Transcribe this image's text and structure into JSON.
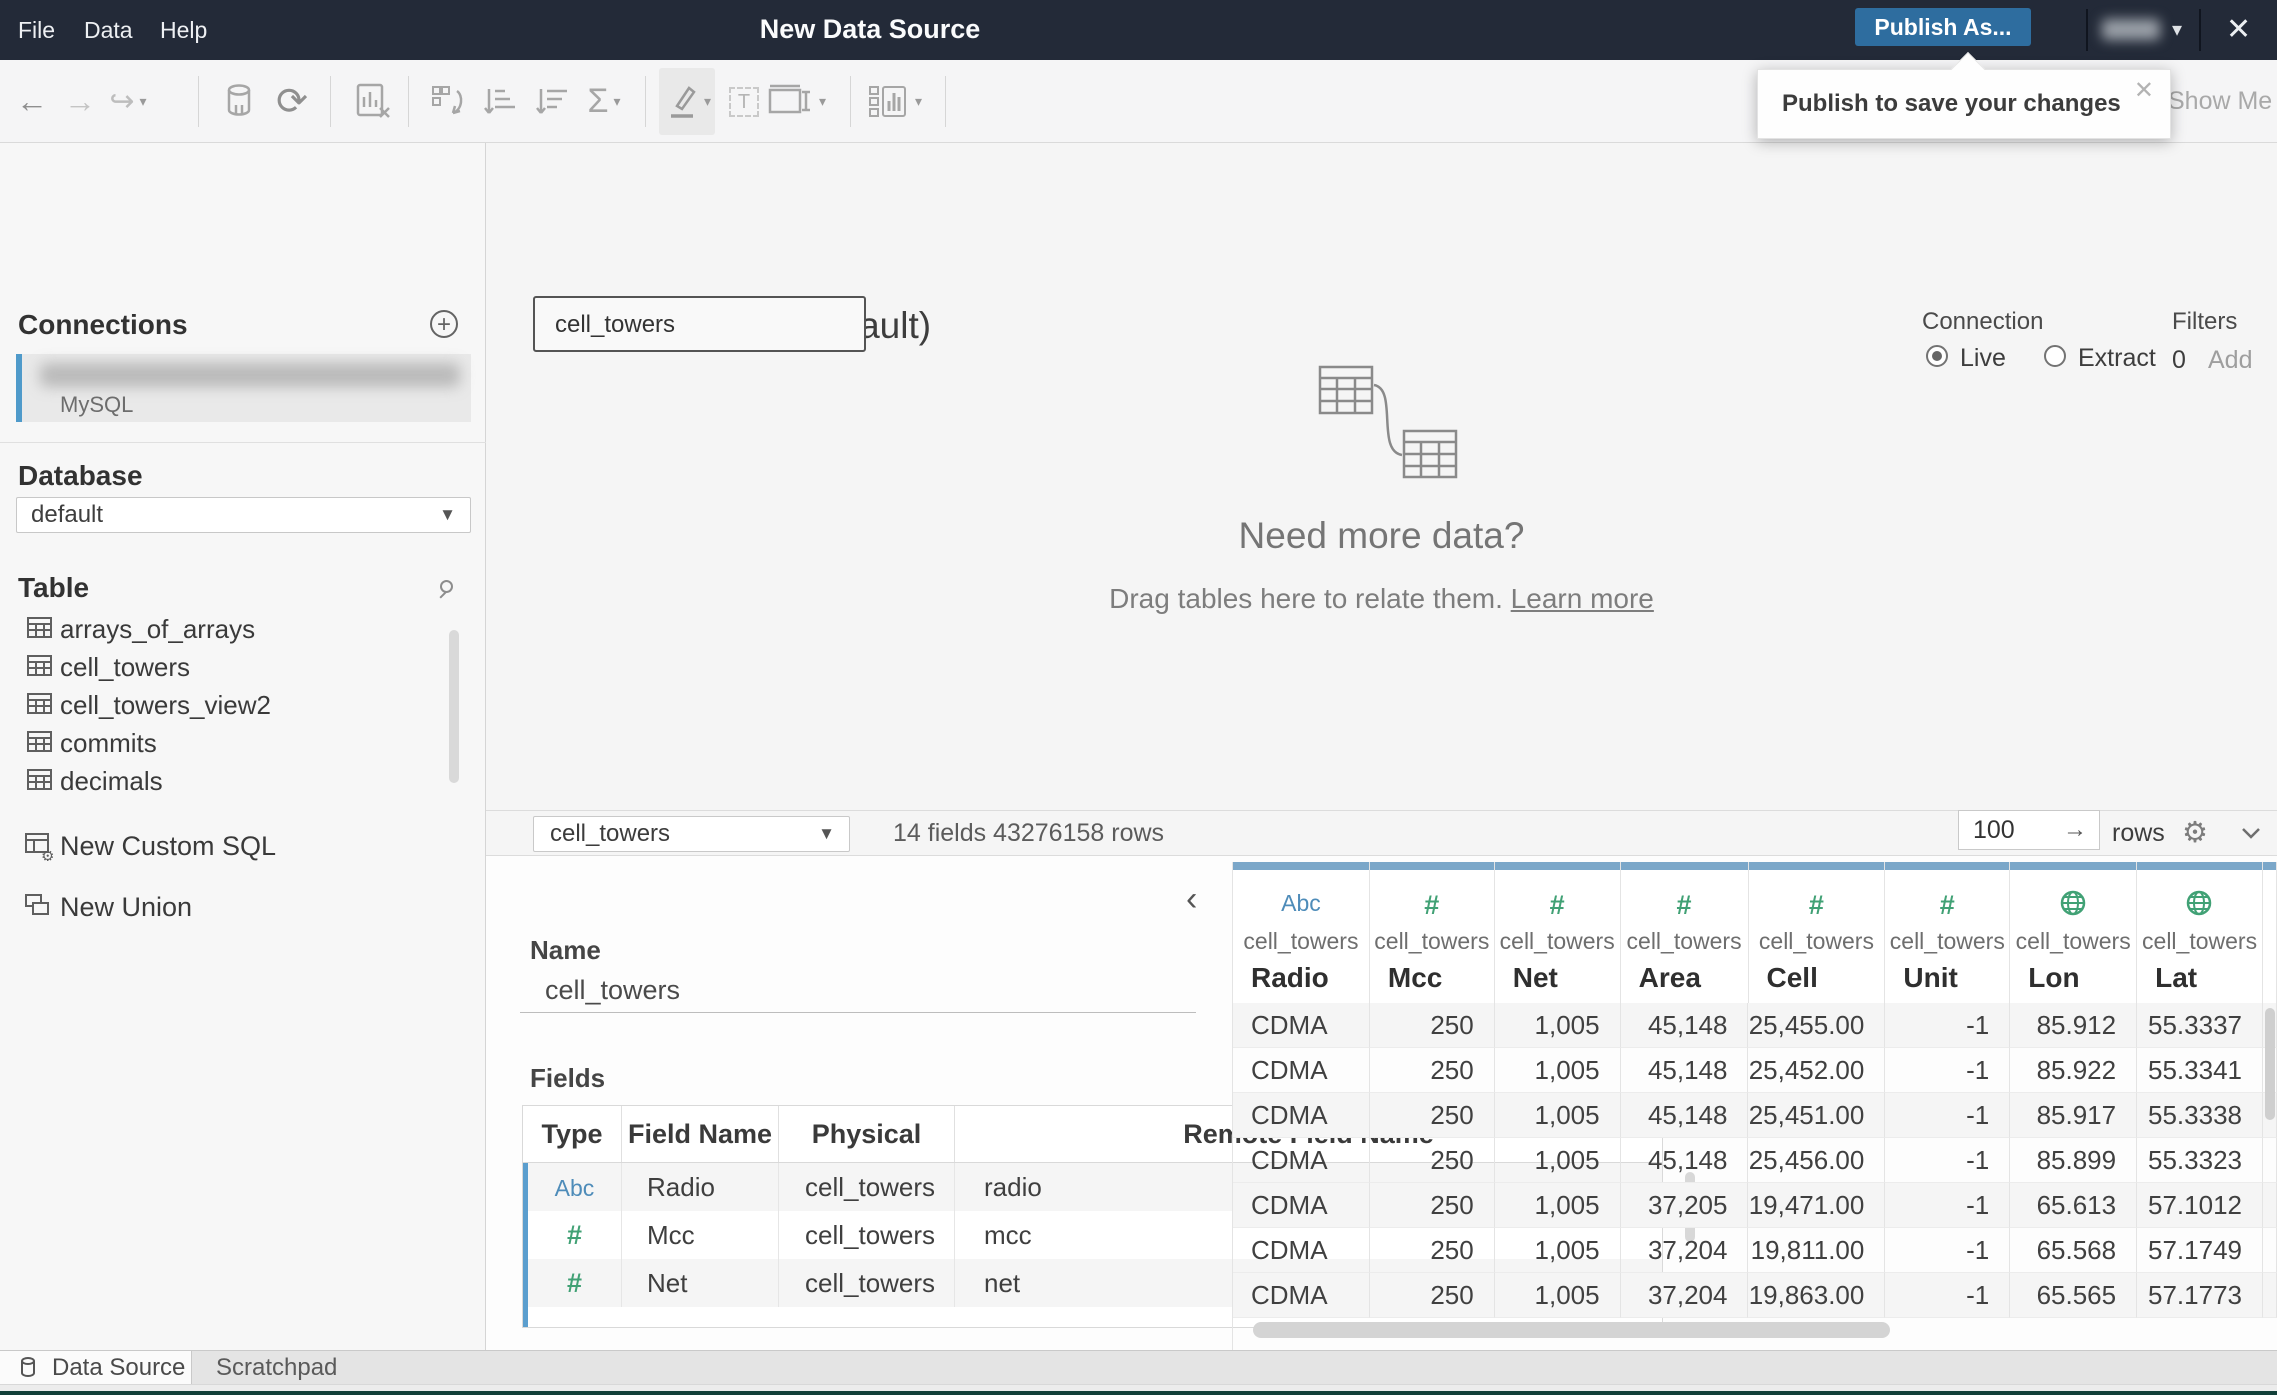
{
  "colors": {
    "topbar": "#232a38",
    "publish_button": "#2e6d9f",
    "string_type_blue": "#4e8cb9",
    "number_type_green": "#41a175",
    "grid_header_bar": "#7ba7c9",
    "connection_accent": "#4f9aca"
  },
  "window": {
    "menus": [
      "File",
      "Data",
      "Help"
    ],
    "title": "New Data Source",
    "publish_button": "Publish As...",
    "close_glyph": "✕"
  },
  "tooltip": {
    "text": "Publish to save your changes",
    "close_glyph": "✕"
  },
  "toolbar": {
    "icons": [
      "back",
      "forward",
      "redo",
      "pause-data-source",
      "refresh-data-source",
      "clear-sheet",
      "swap-rows-columns",
      "sort-ascending",
      "sort-descending",
      "totals-sigma",
      "highlight",
      "text-box",
      "fit-width",
      "show-me-alternatives"
    ],
    "show_me": "Show Me"
  },
  "sidebar": {
    "connections_title": "Connections",
    "connection": {
      "name_blurred": true,
      "subtitle": "MySQL"
    },
    "database_title": "Database",
    "database_selected": "default",
    "table_title": "Table",
    "tables": [
      "arrays_of_arrays",
      "cell_towers",
      "cell_towers_view2",
      "commits",
      "decimals"
    ],
    "new_custom_sql": "New Custom SQL",
    "new_union": "New Union"
  },
  "canvas": {
    "datasource_title": "cell_towers (default)",
    "connection_label": "Connection",
    "connection_options": [
      "Live",
      "Extract"
    ],
    "connection_selected": "Live",
    "filters_label": "Filters",
    "filters_count": "0",
    "filters_add": "Add",
    "table_node": "cell_towers",
    "empty_heading": "Need more data?",
    "empty_body": "Drag tables here to relate them.",
    "empty_link": "Learn more"
  },
  "preview_bar": {
    "table_selected": "cell_towers",
    "summary": "14 fields 43276158 rows",
    "row_count": "100",
    "rows_label": "rows"
  },
  "metadata": {
    "name_label": "Name",
    "name_value": "cell_towers",
    "fields_label": "Fields",
    "columns": [
      "Type",
      "Field Name",
      "Physical Table",
      "Remote Field Name"
    ],
    "rows": [
      {
        "type": "string",
        "type_glyph": "Abc",
        "field": "Radio",
        "physical_table": "cell_towers",
        "remote_field": "radio"
      },
      {
        "type": "number",
        "type_glyph": "#",
        "field": "Mcc",
        "physical_table": "cell_towers",
        "remote_field": "mcc"
      },
      {
        "type": "number",
        "type_glyph": "#",
        "field": "Net",
        "physical_table": "cell_towers",
        "remote_field": "net"
      }
    ]
  },
  "grid": {
    "columns": [
      {
        "name": "Radio",
        "table": "cell_towers",
        "type": "string"
      },
      {
        "name": "Mcc",
        "table": "cell_towers",
        "type": "number"
      },
      {
        "name": "Net",
        "table": "cell_towers",
        "type": "number"
      },
      {
        "name": "Area",
        "table": "cell_towers",
        "type": "number"
      },
      {
        "name": "Cell",
        "table": "cell_towers",
        "type": "number"
      },
      {
        "name": "Unit",
        "table": "cell_towers",
        "type": "number"
      },
      {
        "name": "Lon",
        "table": "cell_towers",
        "type": "geo"
      },
      {
        "name": "Lat",
        "table": "cell_towers",
        "type": "geo"
      }
    ],
    "rows": [
      [
        "CDMA",
        "250",
        "1,005",
        "45,148",
        "25,455.00",
        "-1",
        "85.912",
        "55.3337"
      ],
      [
        "CDMA",
        "250",
        "1,005",
        "45,148",
        "25,452.00",
        "-1",
        "85.922",
        "55.3341"
      ],
      [
        "CDMA",
        "250",
        "1,005",
        "45,148",
        "25,451.00",
        "-1",
        "85.917",
        "55.3338"
      ],
      [
        "CDMA",
        "250",
        "1,005",
        "45,148",
        "25,456.00",
        "-1",
        "85.899",
        "55.3323"
      ],
      [
        "CDMA",
        "250",
        "1,005",
        "37,205",
        "19,471.00",
        "-1",
        "65.613",
        "57.1012"
      ],
      [
        "CDMA",
        "250",
        "1,005",
        "37,204",
        "19,811.00",
        "-1",
        "65.568",
        "57.1749"
      ],
      [
        "CDMA",
        "250",
        "1,005",
        "37,204",
        "19,863.00",
        "-1",
        "65.565",
        "57.1773"
      ]
    ]
  },
  "footer": {
    "tabs": [
      "Data Source",
      "Scratchpad"
    ],
    "active_tab": "Data Source"
  }
}
